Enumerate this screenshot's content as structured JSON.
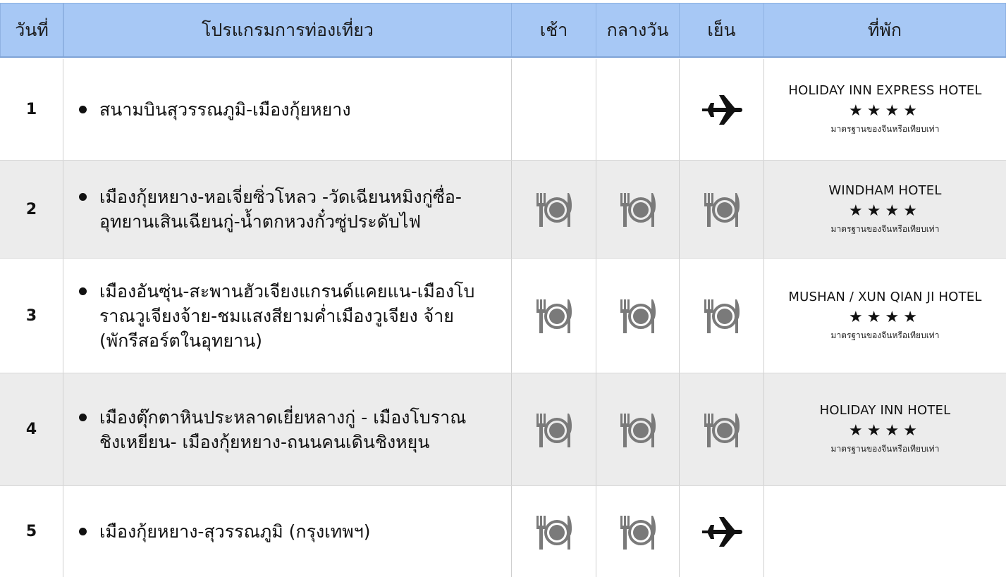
{
  "header": {
    "day": "วันที่",
    "program": "โปรแกรมการท่องเที่ยว",
    "breakfast": "เช้า",
    "lunch": "กลางวัน",
    "dinner": "เย็น",
    "hotel": "ที่พัก"
  },
  "rows": [
    {
      "day": "1",
      "program": "สนามบินสุวรรณภูมิ-เมืองกุ้ยหยาง",
      "breakfast": "",
      "lunch": "",
      "dinner": "plane-icon",
      "hotel": {
        "name": "HOLIDAY INN EXPRESS HOTEL",
        "stars": "★★★★",
        "note": "มาตรฐานของจีนหรือเทียบเท่า"
      }
    },
    {
      "day": "2",
      "program": "เมืองกุ้ยหยาง-หอเจี่ยซิ่วโหลว -วัดเฉียนหมิงกู่ซื่อ-\nอุทยานเสินเฉียนกู่-น้ำตกหวงกั๋วซู่ประดับไฟ",
      "breakfast": "meal-icon",
      "lunch": "meal-icon",
      "dinner": "meal-icon",
      "hotel": {
        "name": "WINDHAM HOTEL",
        "stars": "★★★★",
        "note": "มาตรฐานของจีนหรือเทียบเท่า"
      }
    },
    {
      "day": "3",
      "program": "เมืองอันซุ่น-สะพานฮัวเจียงแกรนด์แคยแน-เมืองโบ\nราณวูเจียงจ้าย-ชมแสงสียามค่ำเมืองวูเจียง จ้าย\n(พักรีสอร์ตในอุทยาน)",
      "breakfast": "meal-icon",
      "lunch": "meal-icon",
      "dinner": "meal-icon",
      "hotel": {
        "name": "MUSHAN / XUN QIAN JI HOTEL",
        "stars": "★★★★",
        "note": "มาตรฐานของจีนหรือเทียบเท่า"
      }
    },
    {
      "day": "4",
      "program": "เมืองตุ๊กตาหินประหลาดเยี่ยหลางกู่ - เมืองโบราณ\nชิงเหยียน- เมืองกุ้ยหยาง-ถนนคนเดินชิงหยุน",
      "breakfast": "meal-icon",
      "lunch": "meal-icon",
      "dinner": "meal-icon",
      "hotel": {
        "name": "HOLIDAY INN HOTEL",
        "stars": "★★★★",
        "note": "มาตรฐานของจีนหรือเทียบเท่า"
      }
    },
    {
      "day": "5",
      "program": "เมืองกุ้ยหยาง-สุวรรณภูมิ (กรุงเทพฯ)",
      "breakfast": "meal-icon",
      "lunch": "meal-icon",
      "dinner": "plane-icon",
      "hotel": {
        "name": "",
        "stars": "",
        "note": ""
      }
    }
  ],
  "colors": {
    "header_bg": "#a7c8f5",
    "alt_row_bg": "#ececec",
    "icon_gray": "#7a7a7a"
  }
}
